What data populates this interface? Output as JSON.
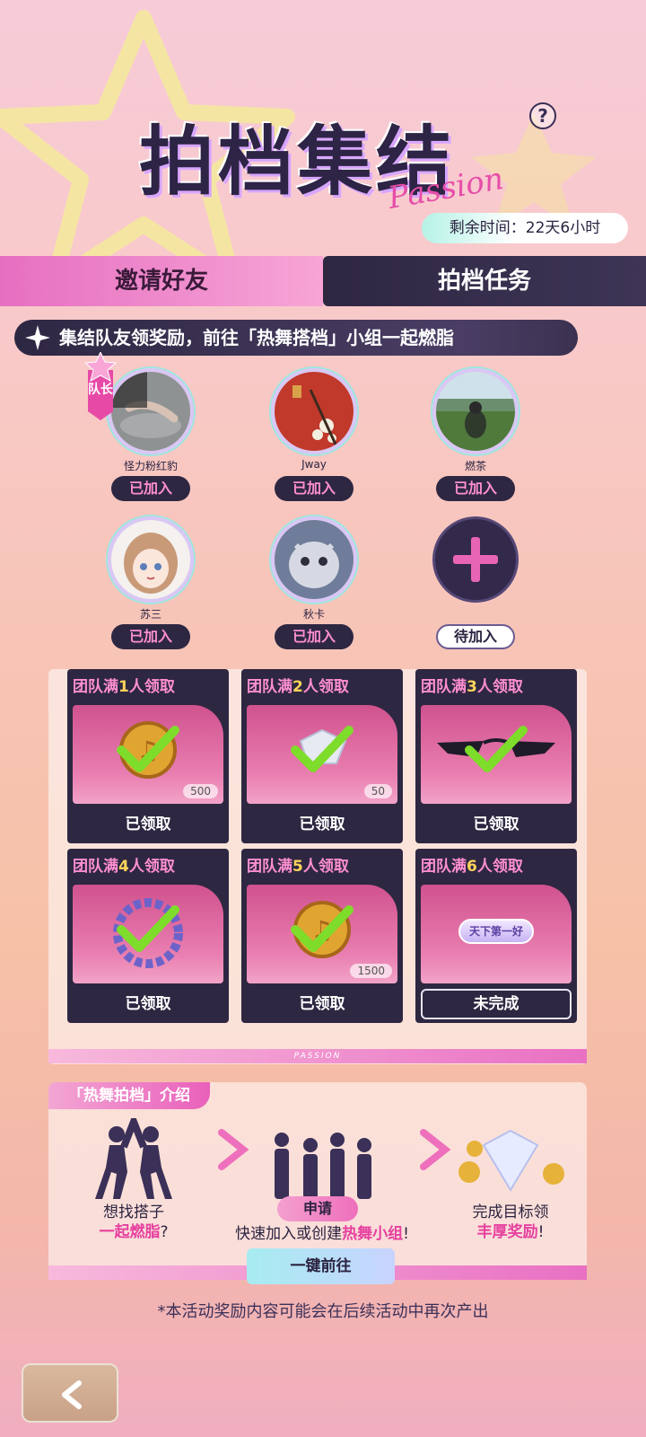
{
  "header": {
    "title": "拍档集结",
    "title_script": "Passion",
    "timer_label": "剩余时间：22天6小时"
  },
  "tabs": [
    {
      "label": "邀请好友",
      "active": true
    },
    {
      "label": "拍档任务",
      "active": false
    }
  ],
  "banner": {
    "text": "集结队友领奖励，前往「热舞搭档」小组一起燃脂"
  },
  "captain_badge": "队长",
  "members": [
    {
      "name": "怪力粉红豹",
      "status": "已加入",
      "captain": true
    },
    {
      "name": "Jway",
      "status": "已加入",
      "captain": false
    },
    {
      "name": "燃茶",
      "status": "已加入",
      "captain": false
    },
    {
      "name": "苏三",
      "status": "已加入",
      "captain": false
    },
    {
      "name": "秋卡",
      "status": "已加入",
      "captain": false
    }
  ],
  "empty_slot": {
    "status": "待加入"
  },
  "rewards": [
    {
      "prefix": "团队满",
      "num": "1",
      "suffix": "人领取",
      "qty": "500",
      "status": "已领取",
      "claimed": true
    },
    {
      "prefix": "团队满",
      "num": "2",
      "suffix": "人领取",
      "qty": "50",
      "status": "已领取",
      "claimed": true
    },
    {
      "prefix": "团队满",
      "num": "3",
      "suffix": "人领取",
      "qty": "",
      "status": "已领取",
      "claimed": true
    },
    {
      "prefix": "团队满",
      "num": "4",
      "suffix": "人领取",
      "qty": "",
      "status": "已领取",
      "claimed": true
    },
    {
      "prefix": "团队满",
      "num": "5",
      "suffix": "人领取",
      "qty": "1500",
      "status": "已领取",
      "claimed": true
    },
    {
      "prefix": "团队满",
      "num": "6",
      "suffix": "人领取",
      "qty": "",
      "status": "未完成",
      "claimed": false,
      "item_label": "天下第一好"
    }
  ],
  "panel_footer": "PASSION",
  "intro": {
    "tag": "「热舞拍档」介绍",
    "col1_line1": "想找搭子",
    "col1_line2": "一起燃脂",
    "col1_tail": "?",
    "col2_line1_pre": "快速加入或创建",
    "col2_line1_hl": "热舞小组",
    "col2_line1_tail": "!",
    "col3_line1": "完成目标领",
    "col3_line2_hl": "丰厚奖励",
    "col3_line2_tail": "!",
    "apply_label": "申请",
    "go_label": "一键前往"
  },
  "notice": "*本活动奖励内容可能会在后续活动中再次产出",
  "colors": {
    "dark": "#2e2742",
    "pink": "#e6409f",
    "yellow": "#ffd35a",
    "check": "#7edc2a"
  }
}
